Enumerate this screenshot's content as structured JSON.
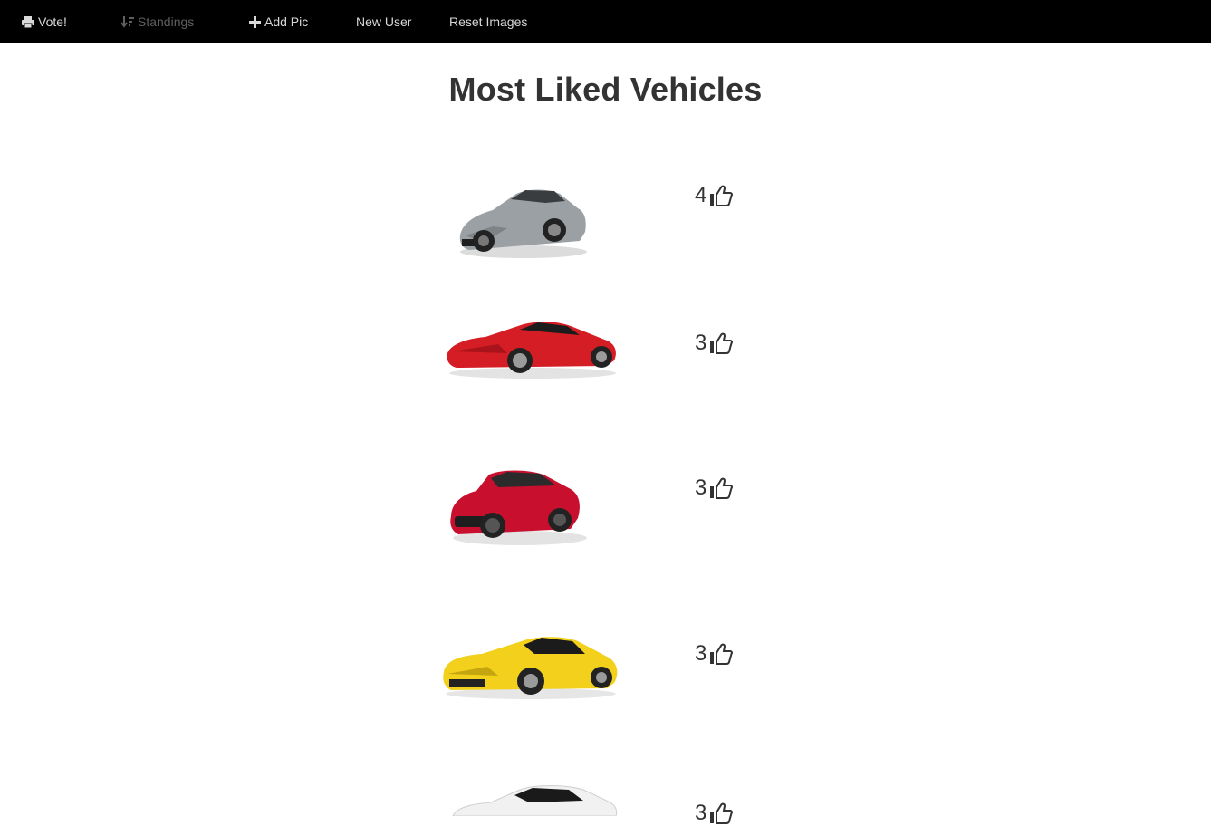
{
  "nav": {
    "vote": "Vote!",
    "standings": "Standings",
    "add_pic": "Add Pic",
    "new_user": "New User",
    "reset_images": "Reset Images"
  },
  "page_title": "Most Liked Vehicles",
  "vehicles": [
    {
      "likes": "4",
      "color": "#9aa0a3",
      "icon": "silver-porsche-918-image"
    },
    {
      "likes": "3",
      "color": "#d41d24",
      "icon": "red-ferrari-laferrari-image"
    },
    {
      "likes": "3",
      "color": "#c8102e",
      "icon": "red-ford-mustang-image"
    },
    {
      "likes": "3",
      "color": "#f2d01b",
      "icon": "yellow-corvette-stingray-image"
    },
    {
      "likes": "3",
      "color": "#f1f1f1",
      "icon": "white-sports-car-image"
    }
  ],
  "icons": {
    "vote": "printer-icon",
    "standings": "sort-icon",
    "add_pic": "plus-icon",
    "likes": "thumbs-up-icon"
  }
}
